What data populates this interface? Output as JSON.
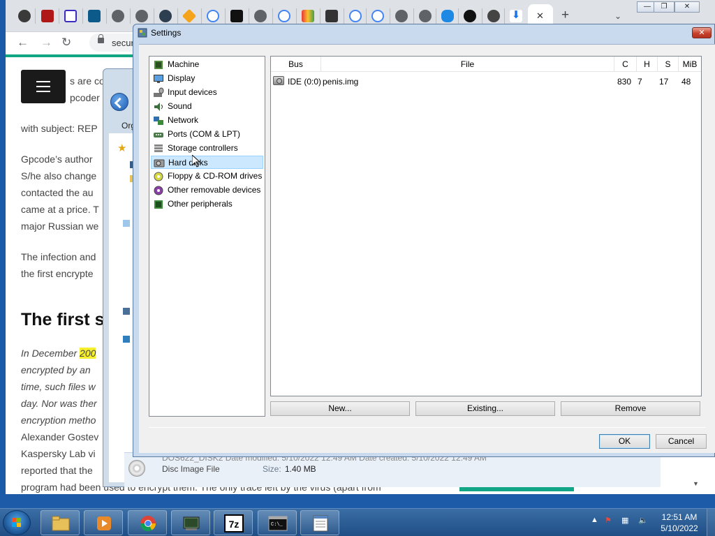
{
  "browser": {
    "address_text": "secure",
    "article_lines": [
      "s are co",
      "pcoder n",
      "with subject: REP",
      "Gpcode’s author",
      "S/he also change",
      "contacted the au",
      "came at a price. T",
      "major Russian we",
      "The infection and",
      "the first encrypte"
    ],
    "heading": "The first s",
    "italic_lines": [
      "In December ",
      "encrypted by an",
      "time, such files w",
      "day. Nor was ther",
      "encryption metho"
    ],
    "highlight": "200",
    "plain_lines": [
      "Alexander Gostev",
      "Kaspersky Lab vi",
      "reported that the",
      "program had been used to encrypt them. The only trace left by the virus (apart from"
    ]
  },
  "explorer": {
    "organize_label": "Org",
    "file_type": "Disc Image File",
    "size_label": "Size:",
    "size_value": "1.40 MB",
    "faded_top": "DOS622_DISK2   Date modified: 5/10/2022 12:49 AM          Date created: 5/10/2022 12:49 AM"
  },
  "dialog": {
    "title": "Settings",
    "tree": [
      {
        "label": "Machine",
        "icon": "machine-icon"
      },
      {
        "label": "Display",
        "icon": "display-icon"
      },
      {
        "label": "Input devices",
        "icon": "input-devices-icon"
      },
      {
        "label": "Sound",
        "icon": "sound-icon"
      },
      {
        "label": "Network",
        "icon": "network-icon"
      },
      {
        "label": "Ports (COM & LPT)",
        "icon": "ports-icon"
      },
      {
        "label": "Storage controllers",
        "icon": "storage-controllers-icon"
      },
      {
        "label": "Hard disks",
        "icon": "hard-disk-icon",
        "selected": true
      },
      {
        "label": "Floppy & CD-ROM drives",
        "icon": "floppy-cdrom-icon"
      },
      {
        "label": "Other removable devices",
        "icon": "removable-devices-icon"
      },
      {
        "label": "Other peripherals",
        "icon": "peripherals-icon"
      }
    ],
    "columns": [
      "Bus",
      "File",
      "C",
      "H",
      "S",
      "MiB"
    ],
    "rows": [
      {
        "bus": "IDE (0:0)",
        "file": "penis.img",
        "c": "830",
        "h": "7",
        "s": "17",
        "mib": "48"
      }
    ],
    "buttons": {
      "new": "New...",
      "existing": "Existing...",
      "remove": "Remove",
      "ok": "OK",
      "cancel": "Cancel"
    }
  },
  "taskbar": {
    "time": "12:51 AM",
    "date": "5/10/2022",
    "apps": [
      "windows-explorer",
      "media-player",
      "chrome",
      "pcem",
      "7-zip",
      "command-prompt",
      "notepad"
    ]
  },
  "colors": {
    "accent_green": "#11a683",
    "highlight_yellow": "#f5ef2c",
    "selection_blue": "#cce8ff"
  }
}
